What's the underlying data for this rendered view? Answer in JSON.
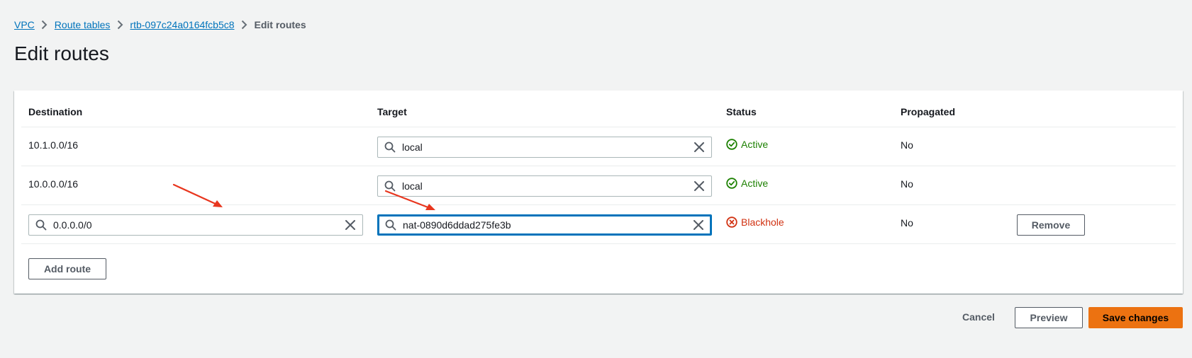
{
  "breadcrumb": {
    "items": [
      "VPC",
      "Route tables",
      "rtb-097c24a0164fcb5c8"
    ],
    "current": "Edit routes"
  },
  "page_title": "Edit routes",
  "table": {
    "headers": [
      "Destination",
      "Target",
      "Status",
      "Propagated"
    ],
    "rows": [
      {
        "destination": "10.1.0.0/16",
        "target": "local",
        "status": "Active",
        "propagated": "No"
      },
      {
        "destination": "10.0.0.0/16",
        "target": "local",
        "status": "Active",
        "propagated": "No"
      },
      {
        "destination": "0.0.0.0/0",
        "target": "nat-0890d6ddad275fe3b",
        "status": "Blackhole",
        "propagated": "No",
        "remove_label": "Remove"
      }
    ]
  },
  "add_route_label": "Add route",
  "footer": {
    "cancel_label": "Cancel",
    "preview_label": "Preview",
    "save_label": "Save changes"
  },
  "colors": {
    "link": "#0073bb",
    "active": "#1d8102",
    "blackhole": "#d13212",
    "primary": "#ec7211",
    "annotation_arrow": "#e8361e"
  },
  "icons": [
    "chevron-right-icon",
    "search-icon",
    "clear-icon",
    "check-circle-icon",
    "x-circle-icon",
    "annotation-arrow"
  ]
}
